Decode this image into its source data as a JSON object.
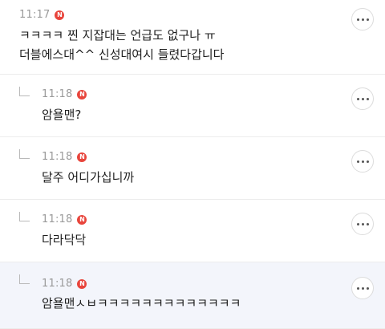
{
  "comments": [
    {
      "time": "11:17",
      "badge": "N",
      "lines": [
        "ㅋㅋㅋㅋ 찐 지잡대는 언급도 없구나 ㅠ",
        "더블에스대^^ 신성대여시 들렸다갑니다"
      ]
    },
    {
      "time": "11:18",
      "badge": "N",
      "lines": [
        "암욜맨?"
      ]
    },
    {
      "time": "11:18",
      "badge": "N",
      "lines": [
        "달주 어디가십니까"
      ]
    },
    {
      "time": "11:18",
      "badge": "N",
      "lines": [
        "다라닥닥"
      ]
    },
    {
      "time": "11:18",
      "badge": "N",
      "lines": [
        "암욜맨ㅅㅂㅋㅋㅋㅋㅋㅋㅋㅋㅋㅋㅋㅋㅋ"
      ]
    }
  ]
}
